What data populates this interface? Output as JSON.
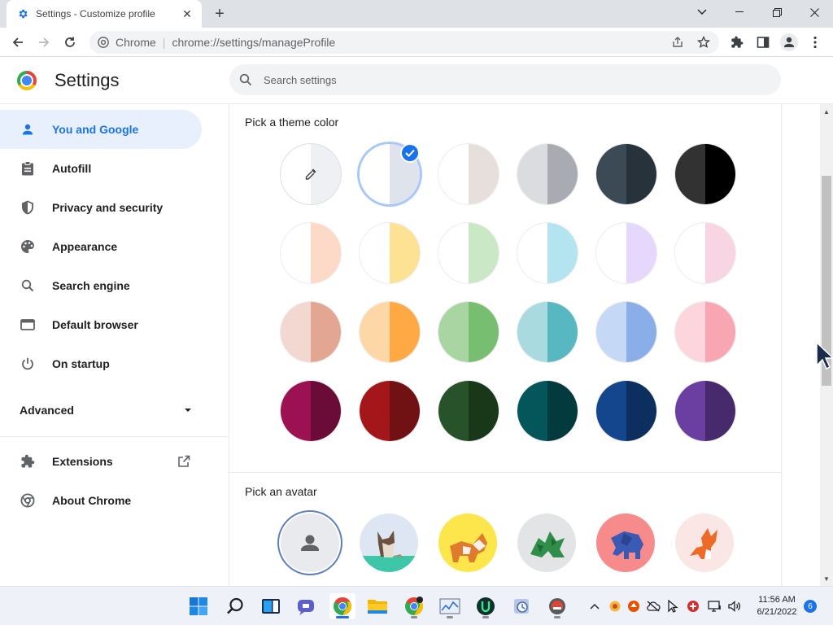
{
  "browser": {
    "tab_title": "Settings - Customize profile",
    "omnibox_site": "Chrome",
    "omnibox_url": "chrome://settings/manageProfile"
  },
  "settings": {
    "title": "Settings",
    "search_placeholder": "Search settings"
  },
  "sidebar": {
    "items": [
      {
        "label": "You and Google",
        "icon": "person-icon",
        "active": true
      },
      {
        "label": "Autofill",
        "icon": "clipboard-icon"
      },
      {
        "label": "Privacy and security",
        "icon": "shield-icon"
      },
      {
        "label": "Appearance",
        "icon": "palette-icon"
      },
      {
        "label": "Search engine",
        "icon": "search-icon"
      },
      {
        "label": "Default browser",
        "icon": "browser-window-icon"
      },
      {
        "label": "On startup",
        "icon": "power-icon"
      }
    ],
    "advanced": "Advanced",
    "extensions": "Extensions",
    "about": "About Chrome"
  },
  "main": {
    "theme_heading": "Pick a theme color",
    "avatar_heading": "Pick an avatar",
    "theme_colors": [
      [
        null,
        {
          "l": "#ffffff",
          "r": "#dfe3eb",
          "selected": true
        },
        {
          "l": "#ffffff",
          "r": "#e6dfdc"
        },
        {
          "l": "#dadce0",
          "r": "#a9abb3"
        },
        {
          "l": "#3c4a56",
          "r": "#28323b"
        },
        {
          "l": "#323232",
          "r": "#000000"
        }
      ],
      [
        {
          "l": "#ffffff",
          "r": "#fddac7"
        },
        {
          "l": "#ffffff",
          "r": "#fde293"
        },
        {
          "l": "#ffffff",
          "r": "#cbe8c6"
        },
        {
          "l": "#ffffff",
          "r": "#b4e4ef"
        },
        {
          "l": "#ffffff",
          "r": "#e6d7fd"
        },
        {
          "l": "#ffffff",
          "r": "#f7d5e2"
        }
      ],
      [
        {
          "l": "#f2d8d0",
          "r": "#e2a693"
        },
        {
          "l": "#fdd7a5",
          "r": "#fea943"
        },
        {
          "l": "#a8d5a2",
          "r": "#78be70"
        },
        {
          "l": "#a8dadf",
          "r": "#58b8c1"
        },
        {
          "l": "#c5d8f6",
          "r": "#8aaee8"
        },
        {
          "l": "#fdd5dd",
          "r": "#f9a6b3"
        }
      ],
      [
        {
          "l": "#9b1152",
          "r": "#6a0c37"
        },
        {
          "l": "#a3171b",
          "r": "#701214"
        },
        {
          "l": "#28532a",
          "r": "#193719"
        },
        {
          "l": "#04565b",
          "r": "#033a3d"
        },
        {
          "l": "#14468e",
          "r": "#0d2f5f"
        },
        {
          "l": "#6b3ea2",
          "r": "#472a6c"
        }
      ]
    ],
    "avatars": [
      {
        "name": "default-person-avatar",
        "bg": "#e8eaed",
        "selected": true
      },
      {
        "name": "cat-origami-avatar",
        "bg": "#dfe6f3"
      },
      {
        "name": "corgi-origami-avatar",
        "bg": "#fde64b"
      },
      {
        "name": "dragon-origami-avatar",
        "bg": "#e2e4e6"
      },
      {
        "name": "elephant-origami-avatar",
        "bg": "#f78b8b"
      },
      {
        "name": "fox-origami-avatar",
        "bg": "#fbe6e6"
      }
    ]
  },
  "taskbar": {
    "time": "11:56 AM",
    "date": "6/21/2022",
    "notifications": "6"
  }
}
